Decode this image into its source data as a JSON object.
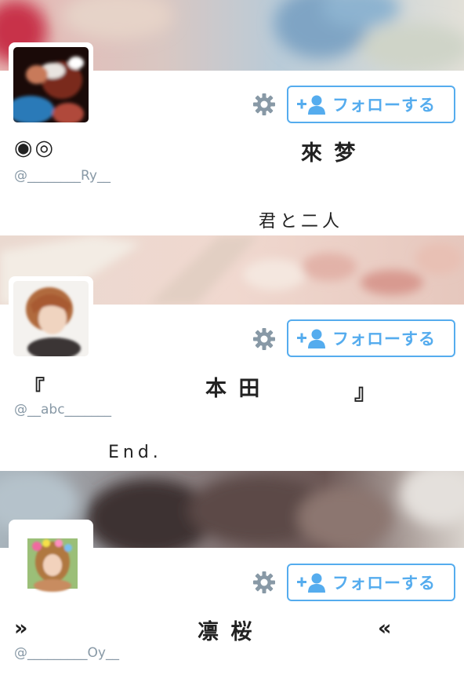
{
  "profiles": [
    {
      "name_left": "◉◎",
      "name_center": "來 梦",
      "name_right": "",
      "handle": "@________Ry__",
      "bio": "君と二人",
      "follow_label": "フォローする"
    },
    {
      "name_left": "『",
      "name_center": "本 田",
      "name_right": "』",
      "handle": "@__abc_______",
      "bio": "End.",
      "follow_label": "フォローする"
    },
    {
      "name_left": "»",
      "name_center": "凛 桜",
      "name_right": "«",
      "handle": "@_________Oy__",
      "bio": "",
      "follow_label": "フォローする"
    }
  ],
  "colors": {
    "accent": "#55acee",
    "handle": "#8899a6",
    "text": "#222222"
  },
  "icons": {
    "settings": "gear-icon",
    "follow": "add-user-icon"
  }
}
